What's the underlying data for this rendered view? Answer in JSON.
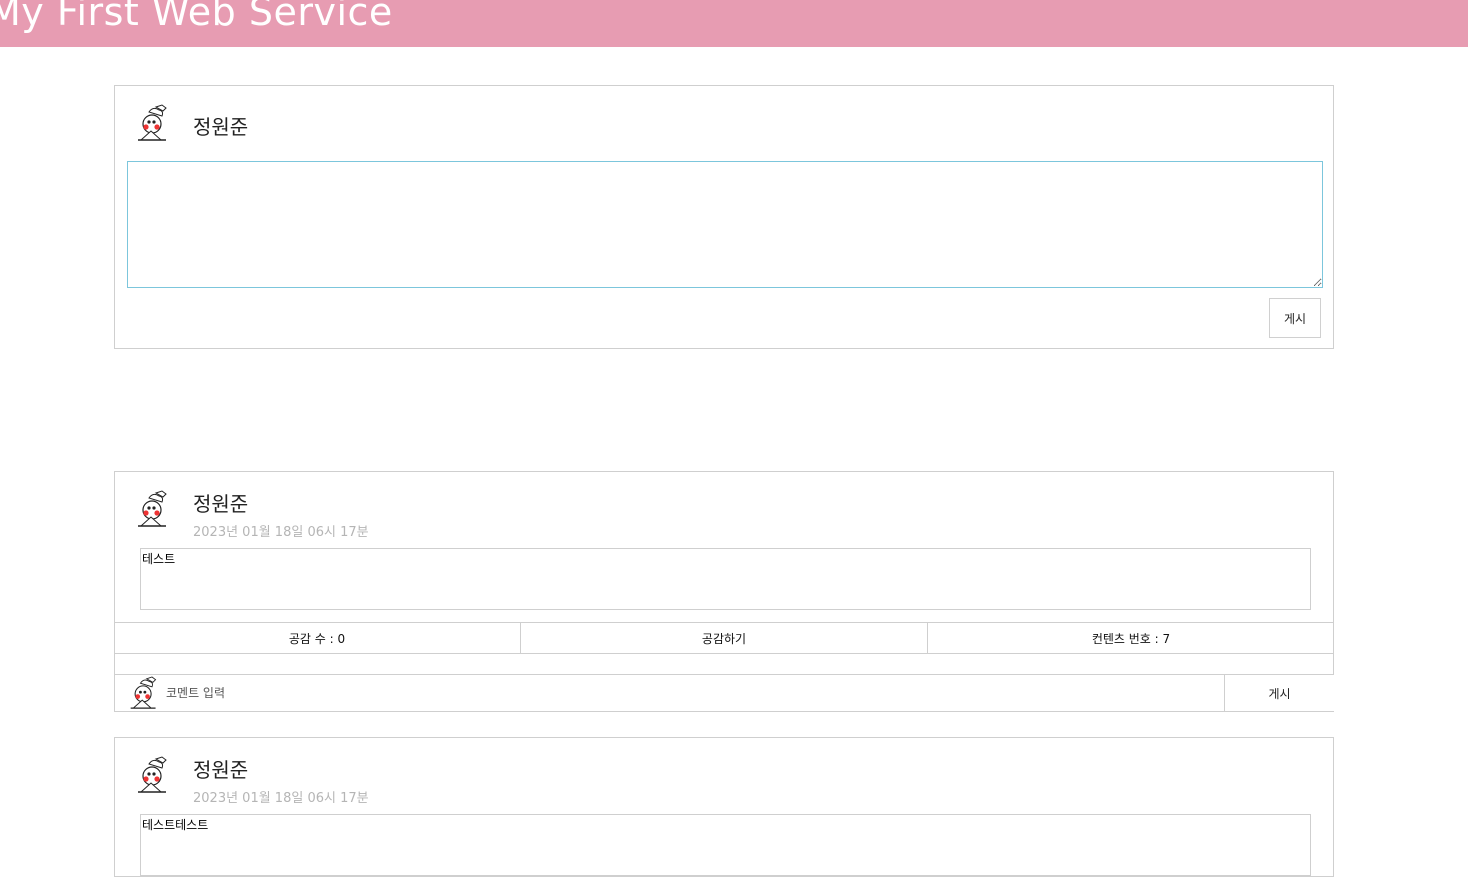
{
  "header": {
    "title": "My First Web Service",
    "color": "#e79cb2"
  },
  "composer": {
    "username": "정원준",
    "text_value": "",
    "post_button": "게시"
  },
  "posts": [
    {
      "username": "정원준",
      "timestamp": "2023년 01월 18일 06시 17분",
      "body": "테스트",
      "like_count": "공감 수 : 0",
      "like_button": "공감하기",
      "content_number": "컨텐츠 번호 : 7",
      "comment_placeholder": "코멘트 입력",
      "comment_button": "게시"
    },
    {
      "username": "정원준",
      "timestamp": "2023년 01월 18일 06시 17분",
      "body": "테스트테스트"
    }
  ]
}
